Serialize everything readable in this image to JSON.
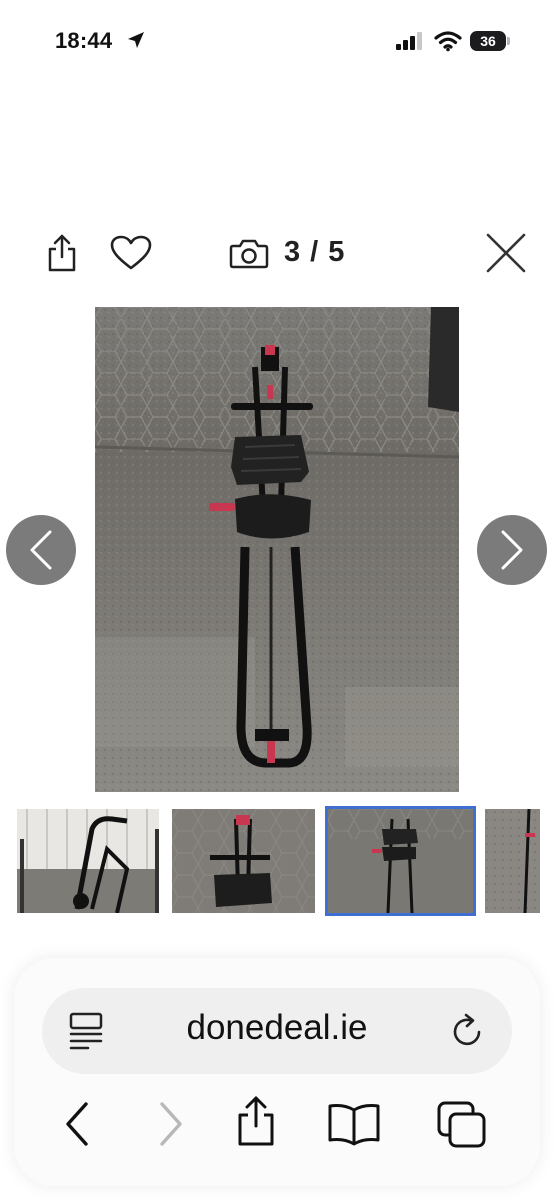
{
  "status_bar": {
    "time": "18:44",
    "battery": "36"
  },
  "viewer": {
    "counter": "3 / 5",
    "icons": [
      "share-icon",
      "heart-icon",
      "camera-icon",
      "close-icon",
      "chevron-left-icon",
      "chevron-right-icon"
    ]
  },
  "thumbnails": {
    "count_visible": 4,
    "selected_index": 2
  },
  "browser": {
    "url": "donedeal.ie",
    "icons": [
      "reader-icon",
      "reload-icon",
      "back-icon",
      "forward-icon",
      "share-icon",
      "bookmarks-icon",
      "tabs-icon"
    ]
  },
  "colors": {
    "accent_selected": "#3f6fd1",
    "nav_arrow_bg": "#7b7b7b",
    "urlbar_bg": "#efefef"
  }
}
